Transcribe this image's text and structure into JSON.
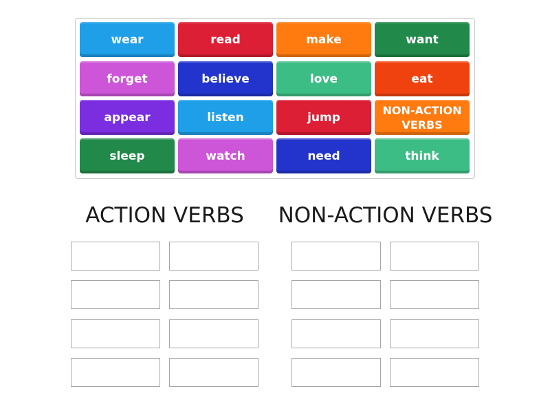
{
  "tiles": [
    {
      "label": "wear",
      "color": "#1e9fe8"
    },
    {
      "label": "read",
      "color": "#dc1f35"
    },
    {
      "label": "make",
      "color": "#ff7a0f"
    },
    {
      "label": "want",
      "color": "#21894a"
    },
    {
      "label": "forget",
      "color": "#cc55d8"
    },
    {
      "label": "believe",
      "color": "#2334cc"
    },
    {
      "label": "love",
      "color": "#3dbd86"
    },
    {
      "label": "eat",
      "color": "#f0420f"
    },
    {
      "label": "appear",
      "color": "#7a2ee0"
    },
    {
      "label": "listen",
      "color": "#1e9fe8"
    },
    {
      "label": "jump",
      "color": "#dc1f35"
    },
    {
      "label": "NON-ACTION VERBS",
      "color": "#ff7a0f"
    },
    {
      "label": "sleep",
      "color": "#21894a"
    },
    {
      "label": "watch",
      "color": "#cc55d8"
    },
    {
      "label": "need",
      "color": "#2334cc"
    },
    {
      "label": "think",
      "color": "#3dbd86"
    }
  ],
  "groups": [
    {
      "title": "ACTION VERBS",
      "slot_count": 8
    },
    {
      "title": "NON-ACTION VERBS",
      "slot_count": 8
    }
  ]
}
